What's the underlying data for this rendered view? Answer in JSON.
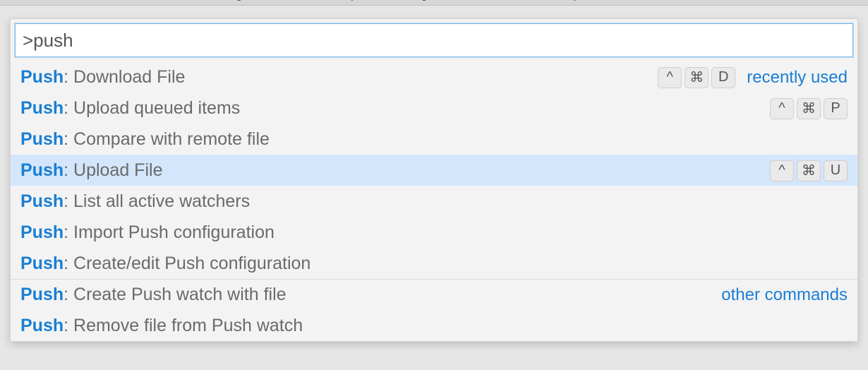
{
  "window": {
    "title_left": "[Extension Development Host]",
    "title_file": "another-test-file.txt",
    "title_project": "push-test"
  },
  "palette": {
    "input_value": ">push",
    "groups": {
      "recent": "recently used",
      "other": "other commands"
    },
    "items": [
      {
        "prefix": "Push",
        "suffix": ": Download File",
        "keys": [
          "^",
          "⌘",
          "D"
        ],
        "group": "recent",
        "selected": false
      },
      {
        "prefix": "Push",
        "suffix": ": Upload queued items",
        "keys": [
          "^",
          "⌘",
          "P"
        ],
        "group": "",
        "selected": false
      },
      {
        "prefix": "Push",
        "suffix": ": Compare with remote file",
        "keys": [],
        "group": "",
        "selected": false
      },
      {
        "prefix": "Push",
        "suffix": ": Upload File",
        "keys": [
          "^",
          "⌘",
          "U"
        ],
        "group": "",
        "selected": true
      },
      {
        "prefix": "Push",
        "suffix": ": List all active watchers",
        "keys": [],
        "group": "",
        "selected": false
      },
      {
        "prefix": "Push",
        "suffix": ": Import Push configuration",
        "keys": [],
        "group": "",
        "selected": false
      },
      {
        "prefix": "Push",
        "suffix": ": Create/edit Push configuration",
        "keys": [],
        "group": "",
        "selected": false
      },
      {
        "prefix": "Push",
        "suffix": ": Create Push watch with file",
        "keys": [],
        "group": "other",
        "selected": false
      },
      {
        "prefix": "Push",
        "suffix": ": Remove file from Push watch",
        "keys": [],
        "group": "",
        "selected": false
      }
    ]
  }
}
